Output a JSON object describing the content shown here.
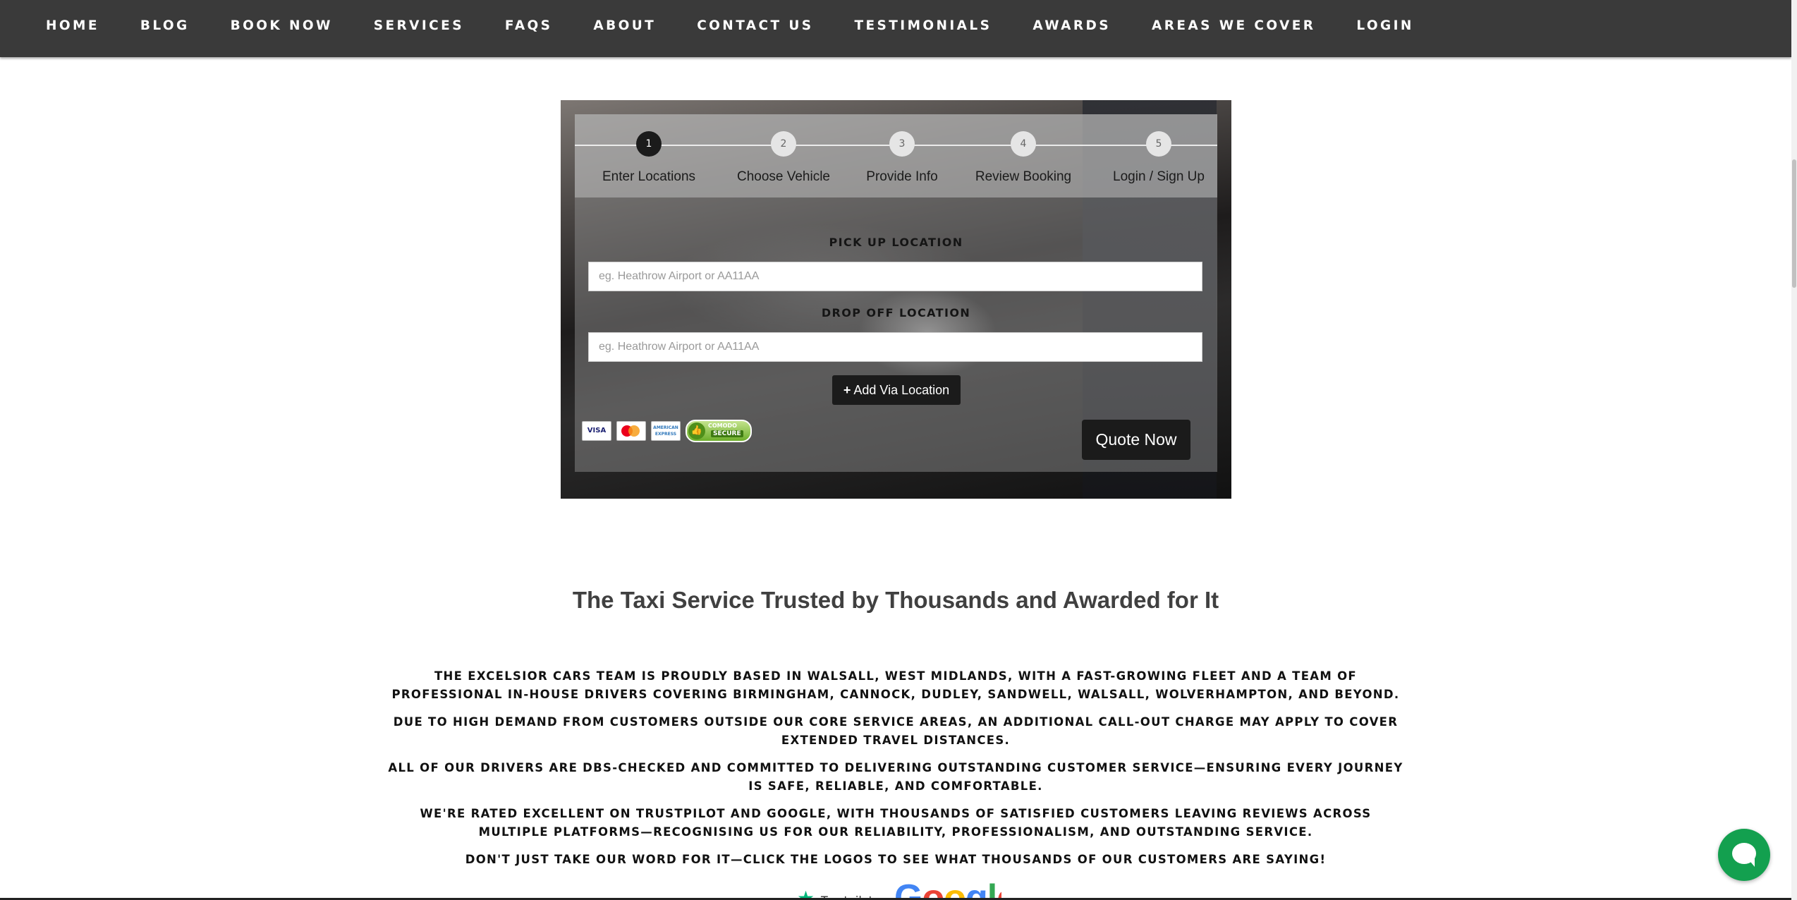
{
  "nav": {
    "items": [
      "HOME",
      "BLOG",
      "BOOK NOW",
      "SERVICES",
      "FAQS",
      "ABOUT",
      "CONTACT US",
      "TESTIMONIALS",
      "AWARDS",
      "AREAS WE COVER",
      "LOGIN"
    ]
  },
  "booking": {
    "steps": [
      {
        "num": "1",
        "label": "Enter Locations"
      },
      {
        "num": "2",
        "label": "Choose Vehicle"
      },
      {
        "num": "3",
        "label": "Provide Info"
      },
      {
        "num": "4",
        "label": "Review Booking"
      },
      {
        "num": "5",
        "label": "Login / Sign Up"
      }
    ],
    "active_step": 1,
    "pickup_label": "PICK UP LOCATION",
    "pickup_placeholder": "eg. Heathrow Airport or AA11AA",
    "dropoff_label": "DROP OFF LOCATION",
    "dropoff_placeholder": "eg. Heathrow Airport or AA11AA",
    "via_button": "Add Via Location",
    "via_icon": "plus-icon",
    "quote_button": "Quote Now",
    "payment": {
      "visa": "VISA",
      "amex": "AMERICAN EXPRESS",
      "seal_top": "COMODO",
      "seal_bottom": "SECURE"
    }
  },
  "content": {
    "headline": "The Taxi Service Trusted by Thousands and Awarded for It",
    "paragraphs": [
      "THE EXCELSIOR CARS TEAM IS PROUDLY BASED IN WALSALL, WEST MIDLANDS, WITH A FAST-GROWING FLEET AND A TEAM OF PROFESSIONAL IN-HOUSE DRIVERS COVERING BIRMINGHAM, CANNOCK, DUDLEY, SANDWELL, WALSALL, WOLVERHAMPTON, AND BEYOND.",
      "DUE TO HIGH DEMAND FROM CUSTOMERS OUTSIDE OUR CORE SERVICE AREAS, AN ADDITIONAL CALL-OUT CHARGE MAY APPLY TO COVER EXTENDED TRAVEL DISTANCES.",
      "ALL OF OUR DRIVERS ARE DBS-CHECKED AND COMMITTED TO DELIVERING OUTSTANDING CUSTOMER SERVICE—ENSURING EVERY JOURNEY IS SAFE, RELIABLE, AND COMFORTABLE.",
      "WE'RE RATED EXCELLENT ON TRUSTPILOT AND GOOGLE, WITH THOUSANDS OF SATISFIED CUSTOMERS LEAVING REVIEWS ACROSS MULTIPLE PLATFORMS—RECOGNISING US FOR OUR RELIABILITY, PROFESSIONALISM, AND OUTSTANDING SERVICE.",
      "DON'T JUST TAKE OUR WORD FOR IT—CLICK THE LOGOS TO SEE WHAT THOUSANDS OF OUR CUSTOMERS ARE SAYING!"
    ]
  },
  "logos": {
    "trustpilot": "Trustpilot",
    "google": "Google"
  },
  "colors": {
    "nav_bg": "#3a3a3a",
    "button_bg": "#1b1b1b",
    "chat_green": "#13a04f",
    "trustpilot_green": "#00b67a"
  }
}
